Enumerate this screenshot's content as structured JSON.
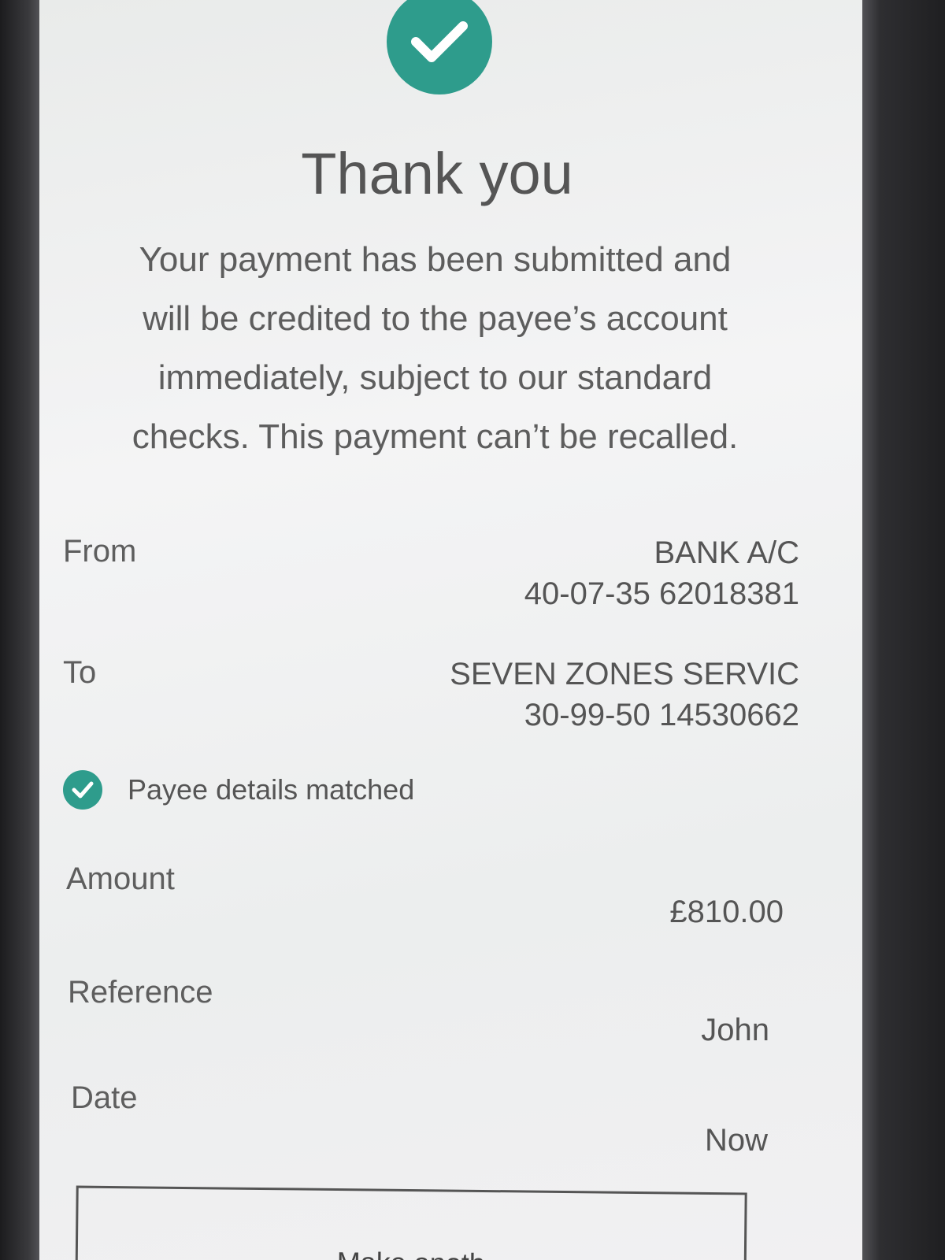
{
  "confirmation": {
    "title": "Thank you",
    "message": "Your payment has been submitted and will be credited to the payee’s account immediately, subject to our standard checks. This payment can’t be recalled."
  },
  "details": {
    "from": {
      "label": "From",
      "name": "BANK A/C",
      "account": "40-07-35 62018381"
    },
    "to": {
      "label": "To",
      "name": "SEVEN ZONES SERVIC",
      "account": "30-99-50 14530662"
    },
    "payee_check": {
      "text": "Payee details matched"
    },
    "amount": {
      "label": "Amount",
      "value": "£810.00"
    },
    "reference": {
      "label": "Reference",
      "value": "John"
    },
    "date": {
      "label": "Date",
      "value": "Now"
    }
  },
  "actions": {
    "make_another_label": "Make anoth"
  },
  "colors": {
    "accent": "#2e9c8c",
    "text": "#5a5a5a",
    "background": "#f0f1f1"
  }
}
